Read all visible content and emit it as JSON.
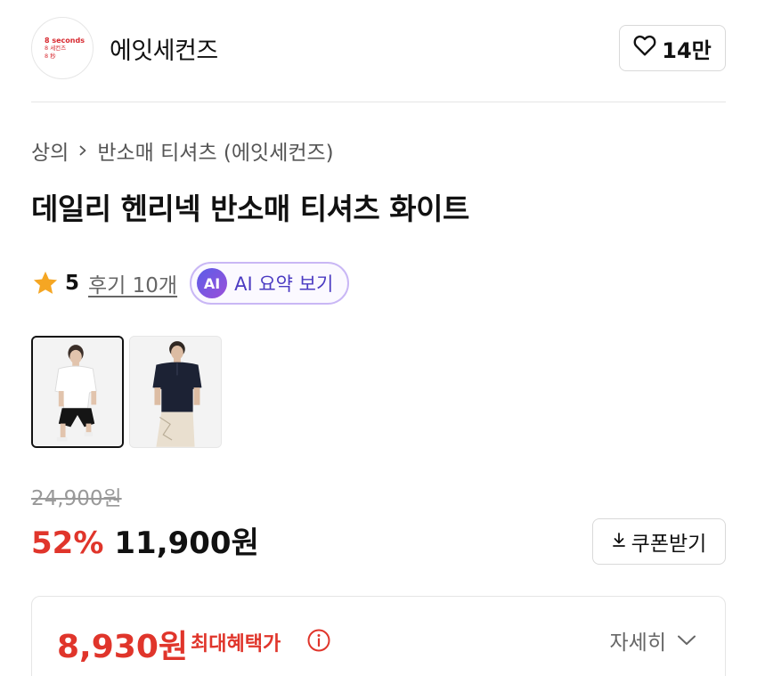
{
  "brand": {
    "logo_lines": [
      "8 seconds",
      "8 세컨즈",
      "8 秒"
    ],
    "name": "에잇세컨즈",
    "like_count": "14만"
  },
  "breadcrumb": {
    "category": "상의",
    "subcategory": "반소매 티셔츠 (에잇세컨즈)"
  },
  "product": {
    "title": "데일리 헨리넥 반소매 티셔츠 화이트",
    "rating": "5",
    "review_link": "후기 10개",
    "ai_badge": "AI",
    "ai_summary_label": "AI 요약 보기",
    "thumbnails": [
      {
        "name": "white-henley",
        "active": true
      },
      {
        "name": "navy-henley",
        "active": false
      }
    ]
  },
  "price": {
    "original": "24,900원",
    "discount": "52%",
    "sale": "11,900원",
    "coupon_label": "쿠폰받기"
  },
  "benefit": {
    "price": "8,930원",
    "label": "최대혜택가",
    "detail_label": "자세히"
  },
  "colors": {
    "accent_red": "#e0352b",
    "ai_purple": "#4b3bc2",
    "star": "#f5a623"
  },
  "icons": [
    "heart-icon",
    "chevron-right-icon",
    "star-icon",
    "download-icon",
    "info-icon",
    "chevron-down-icon"
  ]
}
